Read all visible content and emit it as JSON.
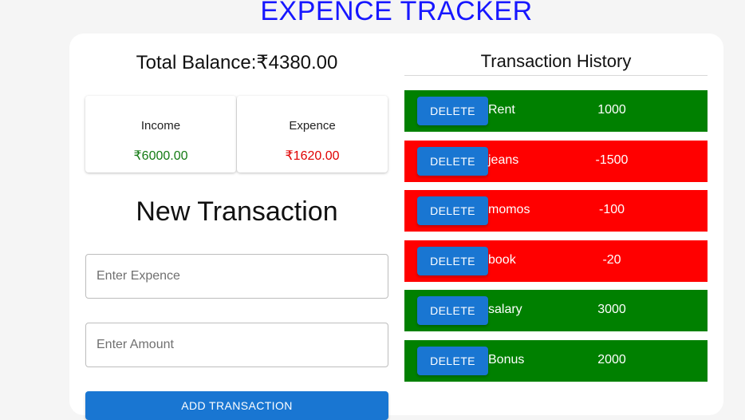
{
  "header": {
    "title": "EXPENCE TRACKER"
  },
  "summary": {
    "balance_text": "Total Balance:₹4380.00",
    "income": {
      "label": "Income",
      "value": "₹6000.00"
    },
    "expence": {
      "label": "Expence",
      "value": "₹1620.00"
    }
  },
  "form": {
    "title": "New Transaction",
    "expence_placeholder": "Enter Expence",
    "expence_value": "",
    "amount_placeholder": "Enter Amount",
    "amount_value": "",
    "submit_label": "ADD TRANSACTION"
  },
  "history": {
    "title": "Transaction History",
    "delete_label": "DELETE",
    "transactions": [
      {
        "name": "Rent",
        "amount": "1000",
        "type": "income"
      },
      {
        "name": "jeans",
        "amount": "-1500",
        "type": "expense"
      },
      {
        "name": "momos",
        "amount": "-100",
        "type": "expense"
      },
      {
        "name": "book",
        "amount": "-20",
        "type": "expense"
      },
      {
        "name": "salary",
        "amount": "3000",
        "type": "income"
      },
      {
        "name": "Bonus",
        "amount": "2000",
        "type": "income"
      }
    ]
  },
  "colors": {
    "title_blue": "#1717ff",
    "income_green": "#008000",
    "expense_red": "#ff0000",
    "button_blue": "#1976d2"
  }
}
